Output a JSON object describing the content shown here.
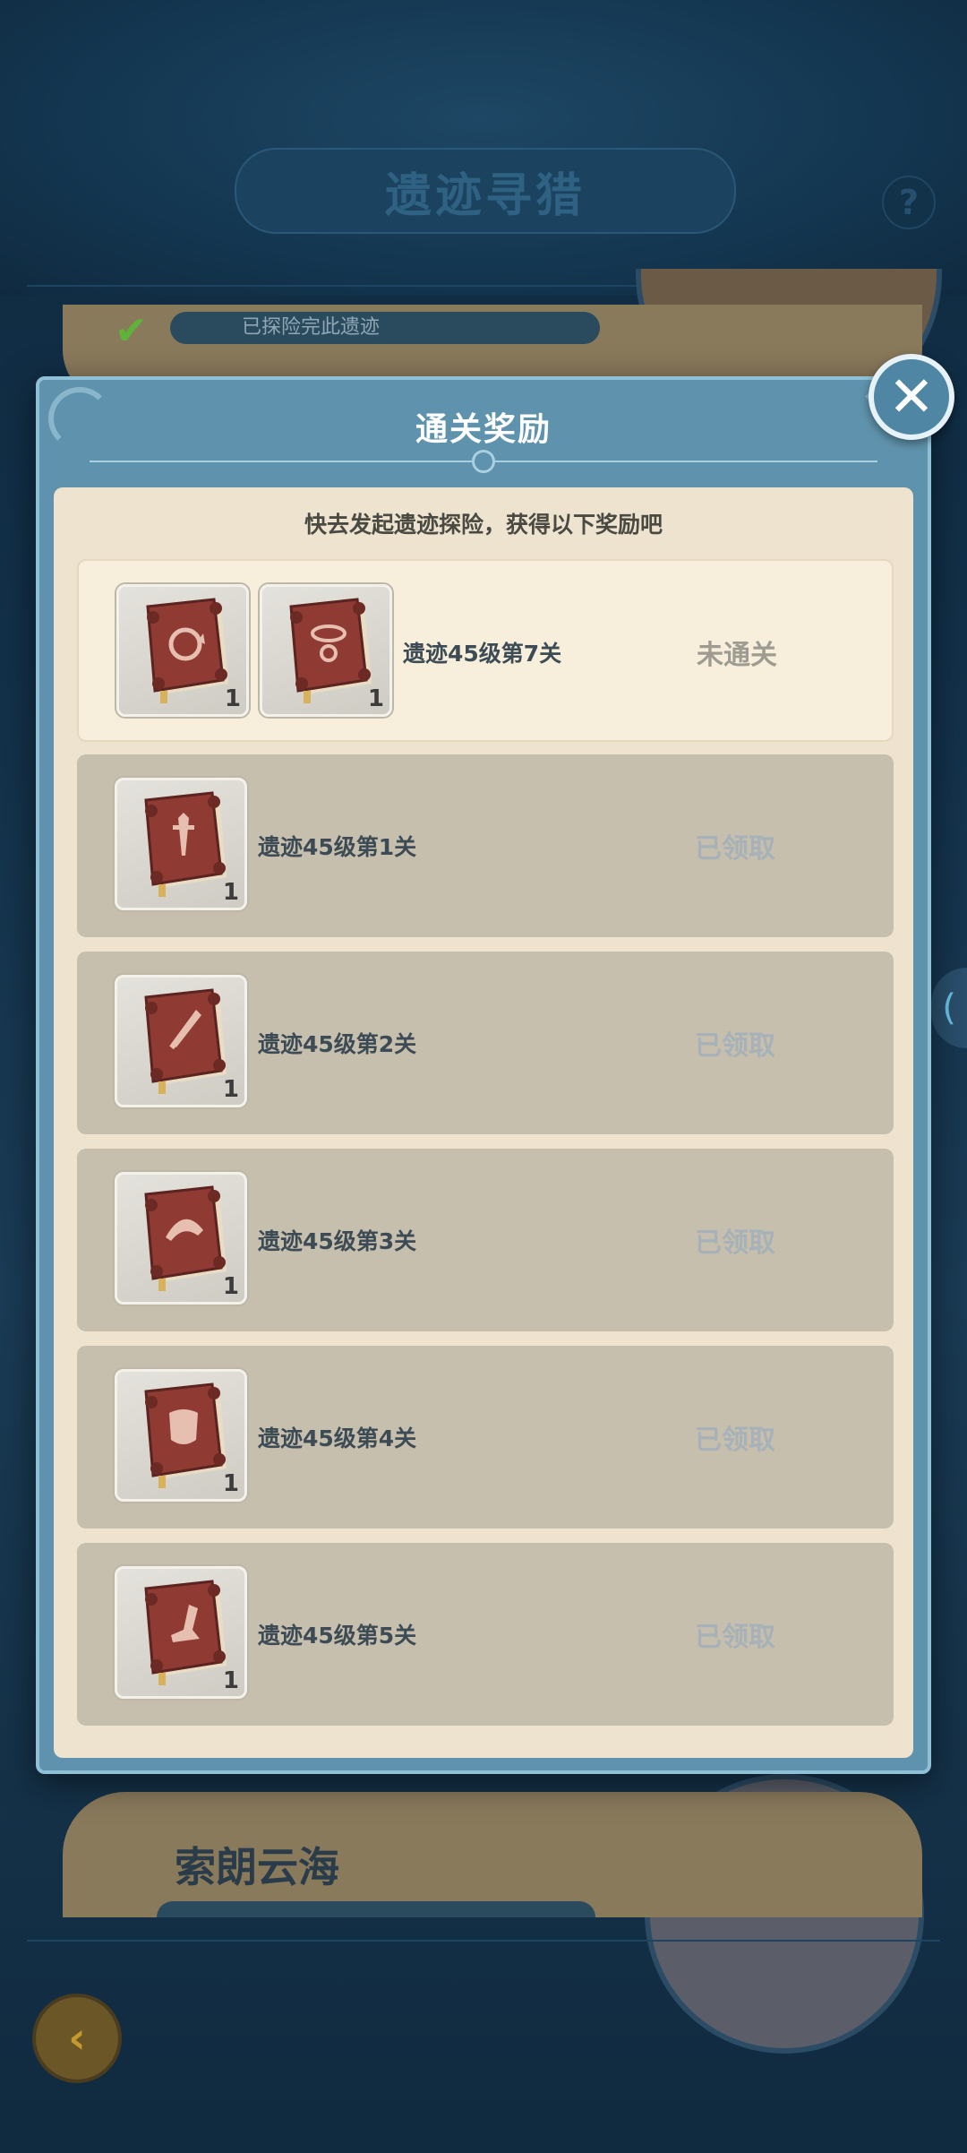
{
  "background": {
    "title": "遗迹寻猎",
    "help_label": "?",
    "top_card_status": "已探险完此遗迹",
    "bottom_card_name": "索朗云海"
  },
  "modal": {
    "title": "通关奖励",
    "subtitle": "快去发起遗迹探险，获得以下奖励吧",
    "close_label": "✕"
  },
  "rewards": [
    {
      "stage": "遗迹45级第7关",
      "status": "未通关",
      "items": [
        {
          "icon": "book-refresh-icon",
          "count": "1"
        },
        {
          "icon": "book-ring-icon",
          "count": "1"
        }
      ]
    },
    {
      "stage": "遗迹45级第1关",
      "status": "已领取",
      "items": [
        {
          "icon": "book-sword-icon",
          "count": "1"
        }
      ]
    },
    {
      "stage": "遗迹45级第2关",
      "status": "已领取",
      "items": [
        {
          "icon": "book-dagger-icon",
          "count": "1"
        }
      ]
    },
    {
      "stage": "遗迹45级第3关",
      "status": "已领取",
      "items": [
        {
          "icon": "book-helmet-icon",
          "count": "1"
        }
      ]
    },
    {
      "stage": "遗迹45级第4关",
      "status": "已领取",
      "items": [
        {
          "icon": "book-armor-icon",
          "count": "1"
        }
      ]
    },
    {
      "stage": "遗迹45级第5关",
      "status": "已领取",
      "items": [
        {
          "icon": "book-boot-icon",
          "count": "1"
        }
      ]
    }
  ],
  "colors": {
    "modal_frame": "#5f93ad",
    "panel": "#ede3cf",
    "row_claimed": "#c7bfae",
    "row_active": "#f7efdc",
    "book": "#8f3a33"
  }
}
